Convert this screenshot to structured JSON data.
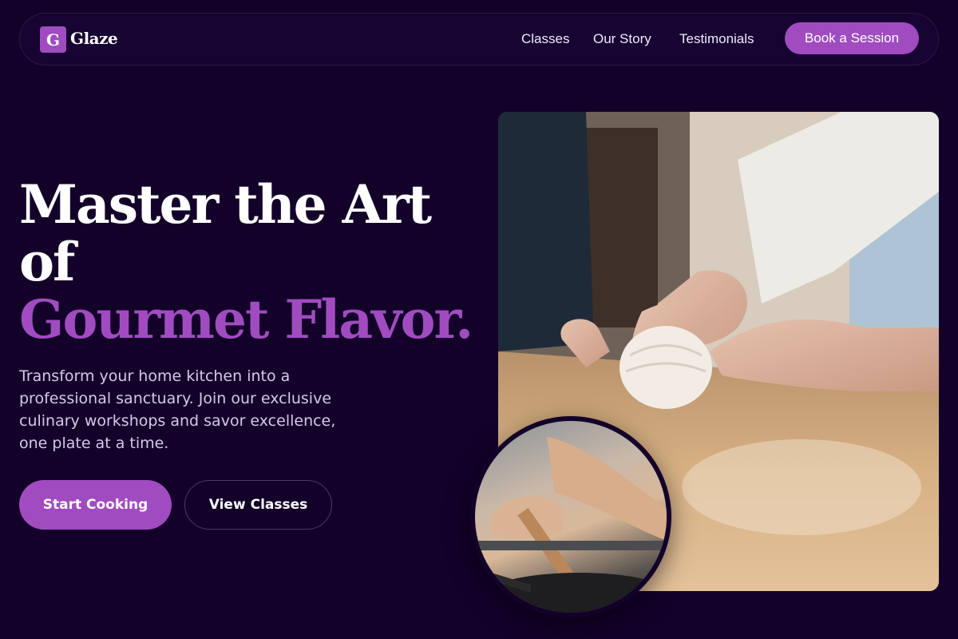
{
  "brand": {
    "logo_letter": "G",
    "name": "Glaze"
  },
  "nav": {
    "links": [
      {
        "label": "Classes"
      },
      {
        "label": "Our Story"
      },
      {
        "label": "Testimonials"
      }
    ],
    "cta_label": "Book a Session"
  },
  "hero": {
    "title_line1": "Master the Art",
    "title_line2": "of",
    "title_line3_accent": "Gourmet Flavor.",
    "subtitle": "Transform your home kitchen into a professional sanctuary. Join our exclusive culinary workshops and savor excellence, one plate at a time.",
    "primary_button": "Start Cooking",
    "secondary_button": "View Classes"
  },
  "images": {
    "main": "hands-kneading-dough-photo",
    "inset": "cooking-pan-stirring-photo"
  },
  "colors": {
    "background": "#13012a",
    "accent": "#a04cc0",
    "text": "#ffffff",
    "muted_text": "#d6c7ea"
  }
}
